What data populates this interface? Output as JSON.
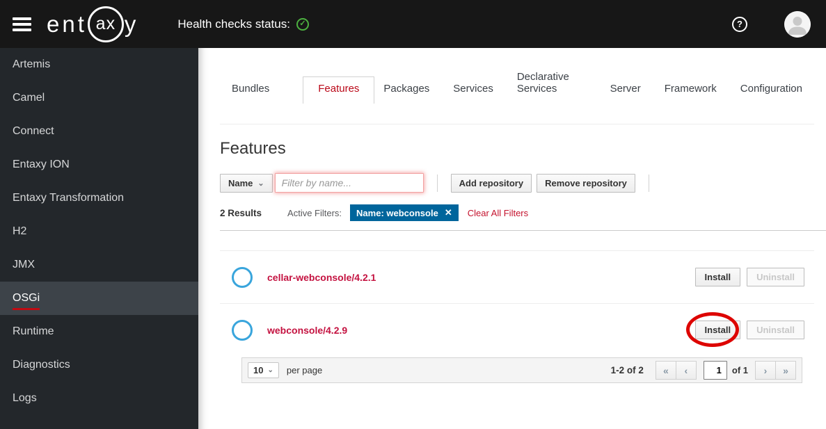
{
  "header": {
    "logo": {
      "left": "ent",
      "circle": "ax",
      "right": "y"
    },
    "health_label": "Health checks status:",
    "health_check_glyph": "✓",
    "help_glyph": "?"
  },
  "sidebar": {
    "items": [
      {
        "label": "Artemis"
      },
      {
        "label": "Camel"
      },
      {
        "label": "Connect"
      },
      {
        "label": "Entaxy ION"
      },
      {
        "label": "Entaxy Transformation"
      },
      {
        "label": "H2"
      },
      {
        "label": "JMX"
      },
      {
        "label": "OSGi"
      },
      {
        "label": "Runtime"
      },
      {
        "label": "Diagnostics"
      },
      {
        "label": "Logs"
      }
    ],
    "selected": "OSGi"
  },
  "tabs": [
    {
      "label": "Bundles"
    },
    {
      "label": "Features"
    },
    {
      "label": "Packages"
    },
    {
      "label": "Services"
    },
    {
      "label": "Declarative Services"
    },
    {
      "label": "Server"
    },
    {
      "label": "Framework"
    },
    {
      "label": "Configuration"
    }
  ],
  "active_tab": "Features",
  "main": {
    "title": "Features",
    "toolbar": {
      "field_selector_label": "Name",
      "chevron_glyph": "⌄",
      "input_value": "",
      "input_placeholder": "Filter by name...",
      "add_repository_label": "Add repository",
      "remove_repository_label": "Remove repository"
    },
    "results": {
      "count_label": "2 Results",
      "active_filters_label": "Active Filters:",
      "chip_label": "Name: webconsole",
      "chip_close_glyph": "✕",
      "clear_all_label": "Clear All Filters"
    },
    "rows": [
      {
        "name": "cellar-webconsole/4.2.1",
        "install_label": "Install",
        "uninstall_label": "Uninstall"
      },
      {
        "name": "webconsole/4.2.9",
        "install_label": "Install",
        "uninstall_label": "Uninstall"
      }
    ],
    "pagination": {
      "per_page_value": "10",
      "per_page_label": "per page",
      "range_label": "1-2 of 2",
      "first_glyph": "«",
      "prev_glyph": "‹",
      "page_value": "1",
      "of_label": "of 1",
      "next_glyph": "›",
      "last_glyph": "»"
    }
  },
  "colors": {
    "topbar_bg": "#171717",
    "sidebar_bg": "#23272b",
    "selected_item_bg": "#3d4349",
    "accent_red": "#c00b13",
    "active_tab_red": "#ba0717",
    "link_red": "#c41240",
    "chip_blue": "#00659c",
    "circle_blue": "#39a5dc",
    "health_green": "#4cb140"
  }
}
